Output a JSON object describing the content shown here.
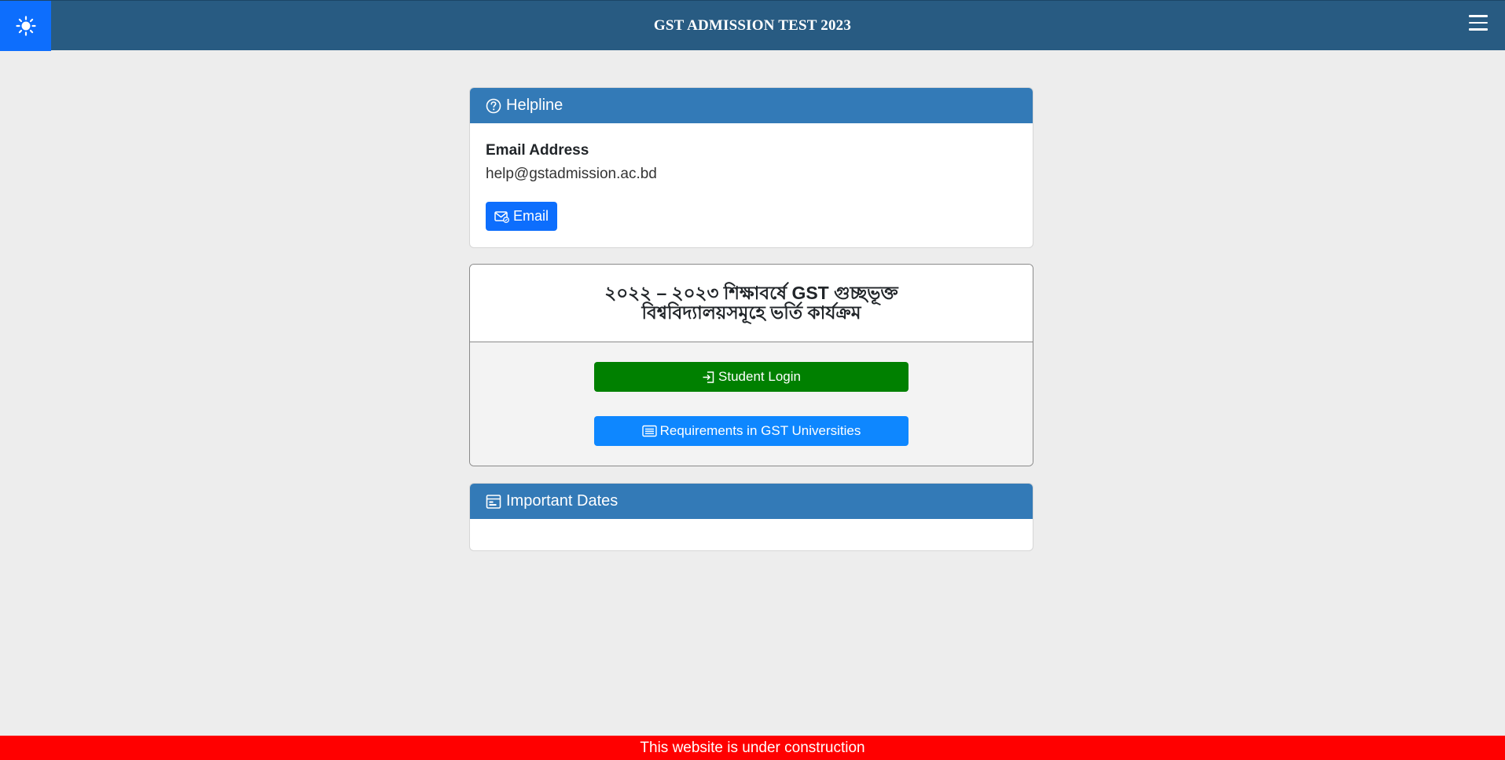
{
  "header": {
    "title": "GST ADMISSION TEST 2023",
    "theme_icon": "sun-icon",
    "menu_icon": "hamburger-menu-icon"
  },
  "helpline": {
    "title": "Helpline",
    "icon": "question-circle-icon",
    "email_label": "Email Address",
    "email_value": "help@gstadmission.ac.bd",
    "email_button_label": "Email",
    "email_button_icon": "envelope-icon"
  },
  "program": {
    "title_line1": "২০২২ – ২০২৩ শিক্ষাবর্ষে GST গুচ্ছভূক্ত",
    "title_line2": "বিশ্ববিদ্যালয়সমূহে ভর্তি কার্যক্রম",
    "login_label": "Student Login",
    "login_icon": "box-arrow-in-right-icon",
    "requirements_label": "Requirements in GST Universities",
    "requirements_icon": "list-card-icon"
  },
  "dates": {
    "title": "Important Dates",
    "icon": "calendar-icon"
  },
  "footer": {
    "notice": "This website is under construction"
  },
  "colors": {
    "topbar": "#285b82",
    "theme_button": "#0d6efd",
    "card_header": "#337ab7",
    "login_button": "#008000",
    "requirements_button": "#0e87ff",
    "footer": "#ff0000"
  }
}
